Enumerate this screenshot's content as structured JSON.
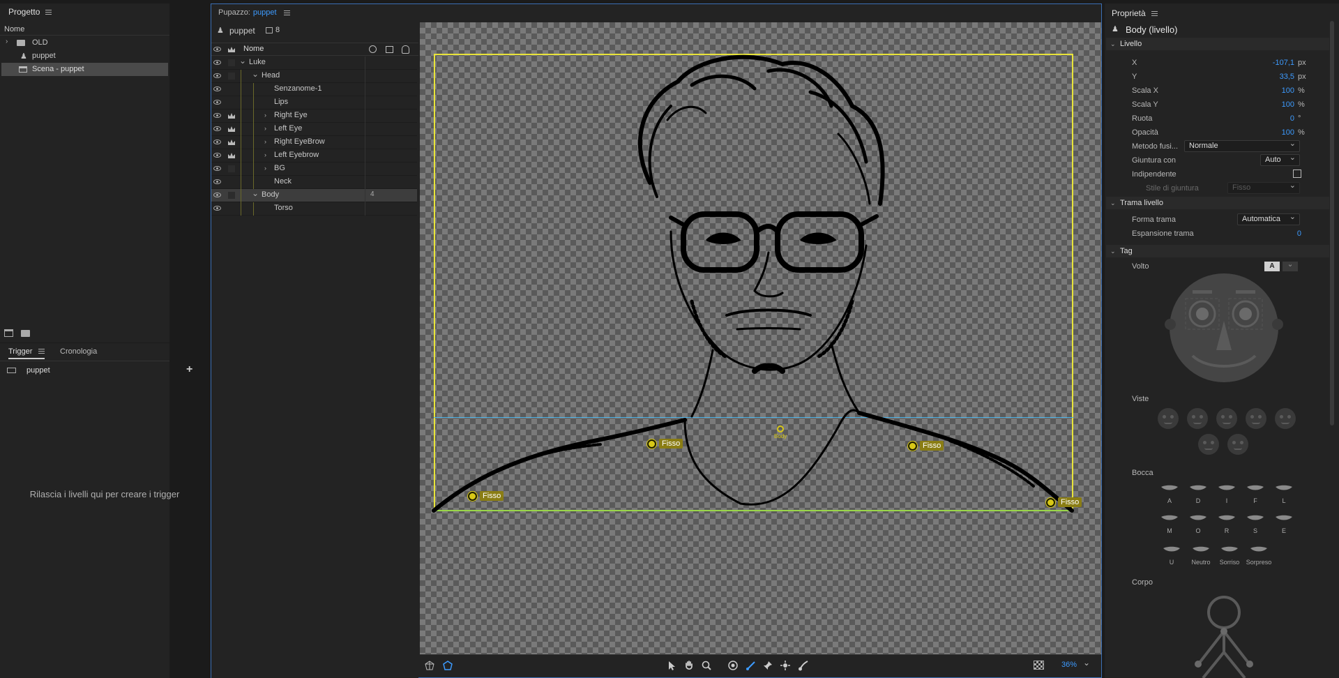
{
  "project_panel": {
    "title": "Progetto",
    "column": "Nome",
    "items": [
      {
        "label": "OLD",
        "type": "folder"
      },
      {
        "label": "puppet",
        "type": "puppet"
      },
      {
        "label": "Scena - puppet",
        "type": "scene"
      }
    ]
  },
  "trigger_panel": {
    "tab_trigger": "Trigger",
    "tab_history": "Cronologia",
    "puppet": "puppet",
    "drop_hint": "Rilascia i livelli qui per creare i trigger"
  },
  "puppet_panel": {
    "title_prefix": "Pupazzo:",
    "title_name": "puppet",
    "puppet_name": "puppet",
    "count": "8",
    "column_name": "Nome",
    "layers": [
      {
        "name": "Luke",
        "indent": 1,
        "chev": "v",
        "crown": false
      },
      {
        "name": "Head",
        "indent": 2,
        "chev": "v",
        "crown": false
      },
      {
        "name": "Senzanome-1",
        "indent": 3,
        "chev": "",
        "crown": false
      },
      {
        "name": "Lips",
        "indent": 3,
        "chev": "",
        "crown": false
      },
      {
        "name": "Right Eye",
        "indent": 3,
        "chev": ">",
        "crown": true
      },
      {
        "name": "Left Eye",
        "indent": 3,
        "chev": ">",
        "crown": true
      },
      {
        "name": "Right EyeBrow",
        "indent": 3,
        "chev": ">",
        "crown": true
      },
      {
        "name": "Left Eyebrow",
        "indent": 3,
        "chev": ">",
        "crown": true
      },
      {
        "name": "BG",
        "indent": 3,
        "chev": ">",
        "crown": false
      },
      {
        "name": "Neck",
        "indent": 3,
        "chev": "",
        "crown": false
      },
      {
        "name": "Body",
        "indent": 2,
        "chev": "v",
        "crown": false,
        "selected": true,
        "count": "4"
      },
      {
        "name": "Torso",
        "indent": 3,
        "chev": "",
        "crown": false
      }
    ]
  },
  "canvas": {
    "pins": [
      "Fisso",
      "Fisso",
      "Fisso",
      "Fisso"
    ],
    "origin_label": "Body",
    "zoom": "36%"
  },
  "properties": {
    "title": "Proprietà",
    "layer_title": "Body (livello)",
    "section_livello": "Livello",
    "x_label": "X",
    "x_value": "-107,1",
    "x_unit": "px",
    "y_label": "Y",
    "y_value": "33,5",
    "y_unit": "px",
    "scalex_label": "Scala X",
    "scalex_value": "100",
    "scalex_unit": "%",
    "scaley_label": "Scala Y",
    "scaley_value": "100",
    "scaley_unit": "%",
    "rot_label": "Ruota",
    "rot_value": "0",
    "rot_unit": "°",
    "opacity_label": "Opacità",
    "opacity_value": "100",
    "opacity_unit": "%",
    "blend_label": "Metodo fusi...",
    "blend_value": "Normale",
    "join_label": "Giuntura con",
    "join_value": "Auto",
    "indep_label": "Indipendente",
    "joinstyle_label": "Stile di giuntura",
    "joinstyle_value": "Fisso",
    "section_trama": "Trama livello",
    "mesh_label": "Forma trama",
    "mesh_value": "Automatica",
    "expand_label": "Espansione trama",
    "expand_value": "0",
    "section_tag": "Tag",
    "face_label": "Volto",
    "views_label": "Viste",
    "mouth_label": "Bocca",
    "mouth_row1": [
      "A",
      "D",
      "I",
      "F",
      "L"
    ],
    "mouth_row2": [
      "M",
      "O",
      "R",
      "S",
      "E"
    ],
    "mouth_row3": [
      "U",
      "Neutro",
      "Sorriso",
      "Sorpreso"
    ],
    "body_label": "Corpo"
  }
}
